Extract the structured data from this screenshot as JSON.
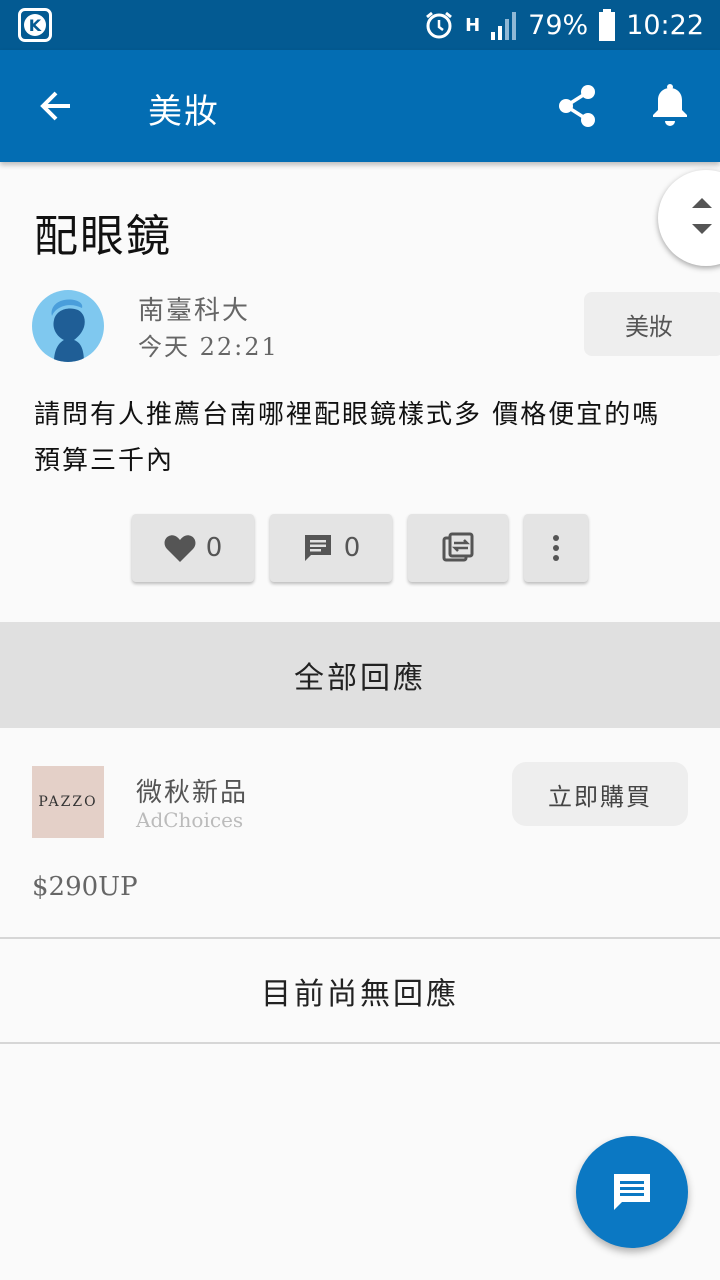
{
  "status_bar": {
    "network": "H",
    "battery": "79%",
    "time": "10:22"
  },
  "app_bar": {
    "title": "美妝"
  },
  "post": {
    "title": "配眼鏡",
    "author": "南臺科大",
    "time": "今天 22:21",
    "category": "美妝",
    "body": "請問有人推薦台南哪裡配眼鏡樣式多 價格便宜的嗎  預算三千內",
    "likes": "0",
    "comments": "0"
  },
  "replies": {
    "header": "全部回應",
    "empty": "目前尚無回應"
  },
  "ad": {
    "logo_text": "PAZZO",
    "title": "微秋新品",
    "sub": "AdChoices",
    "cta": "立即購買",
    "price": "$290UP"
  },
  "colors": {
    "status_bar": "#035a92",
    "app_bar": "#036db3",
    "fab": "#0b78c3"
  }
}
